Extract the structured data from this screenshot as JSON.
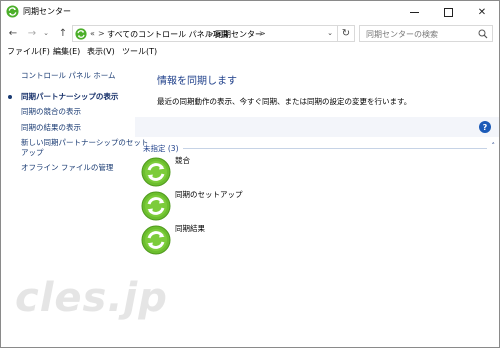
{
  "window": {
    "title": "同期センター",
    "controls": {
      "minimize_icon": "minimize-icon",
      "maximize_icon": "maximize-icon",
      "close_glyph": "✕"
    }
  },
  "nav": {
    "back_glyph": "←",
    "forward_glyph": "→",
    "history_glyph": "⌄",
    "up_glyph": "↑",
    "address_chevron": "«",
    "breadcrumb": [
      "すべてのコントロール パネル項目",
      "同期センター"
    ],
    "separator": ">",
    "dropdown_glyph": "⌄",
    "refresh_glyph": "↻",
    "search_placeholder": "同期センターの検索"
  },
  "menu": [
    {
      "label": "ファイル(F)"
    },
    {
      "label": "編集(E)"
    },
    {
      "label": "表示(V)"
    },
    {
      "label": "ツール(T)"
    }
  ],
  "sidebar": {
    "home": "コントロール パネル ホーム",
    "links": [
      {
        "label": "同期パートナーシップの表示",
        "active": true
      },
      {
        "label": "同期の競合の表示",
        "active": false
      },
      {
        "label": "同期の結果の表示",
        "active": false
      },
      {
        "label": "新しい同期パートナーシップのセット",
        "active": false
      },
      {
        "label": "アップ",
        "active": false
      },
      {
        "label": "オフライン ファイルの管理",
        "active": false
      }
    ]
  },
  "main": {
    "title": "情報を同期します",
    "description": "最近の同期動作の表示、今すぐ同期、または同期の設定の変更を行います。",
    "help_glyph": "?",
    "group_header": "未指定 (3)",
    "collapse_glyph": "˄",
    "items": [
      {
        "label": "競合",
        "icon": "sync-icon"
      },
      {
        "label": "同期のセットアップ",
        "icon": "sync-icon"
      },
      {
        "label": "同期結果",
        "icon": "sync-icon"
      }
    ]
  },
  "watermark": "cles.jp",
  "colors": {
    "accent": "#1e3f8a",
    "link": "#1a3b73",
    "sync_green": "#6cbe2e",
    "help_blue": "#1c5bb8"
  }
}
